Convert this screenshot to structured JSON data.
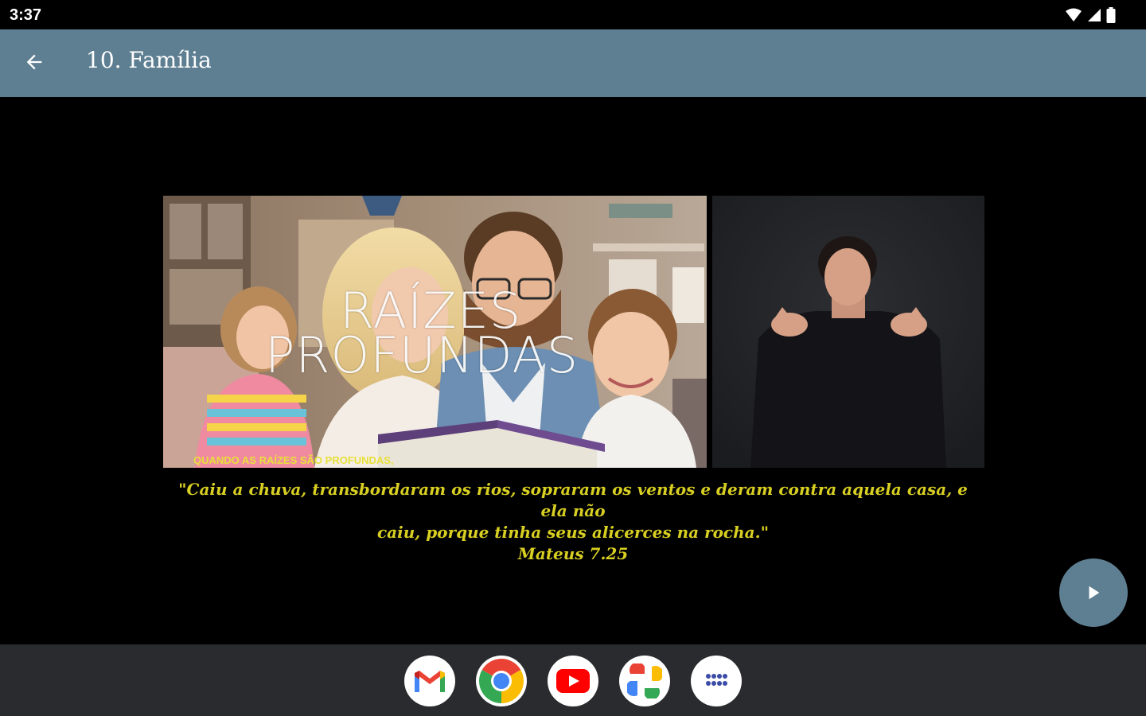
{
  "status_bar": {
    "time": "3:37"
  },
  "app_bar": {
    "title": "10. Família"
  },
  "video": {
    "title_line1": "RAÍZES",
    "title_line2": "PROFUNDAS",
    "caption": "QUANDO AS RAÍZES SÃO PROFUNDAS,"
  },
  "quote": {
    "line1": "\"Caiu a chuva, transbordaram os rios, sopraram os ventos e deram contra aquela casa, e ela não",
    "line2": "caiu, porque tinha seus alicerces na rocha.\"",
    "reference": "Mateus 7.25"
  },
  "colors": {
    "app_bar": "#5e7f92",
    "quote_text": "#d8cf22",
    "caption_text": "#e8e03a",
    "taskbar": "#2a2b2e"
  },
  "icons": {
    "back": "arrow-back-icon",
    "play": "play-icon",
    "wifi": "wifi-icon",
    "signal": "signal-icon",
    "battery": "battery-icon"
  },
  "dock_apps": [
    "Gmail",
    "Chrome",
    "YouTube",
    "Photos",
    "All apps"
  ]
}
